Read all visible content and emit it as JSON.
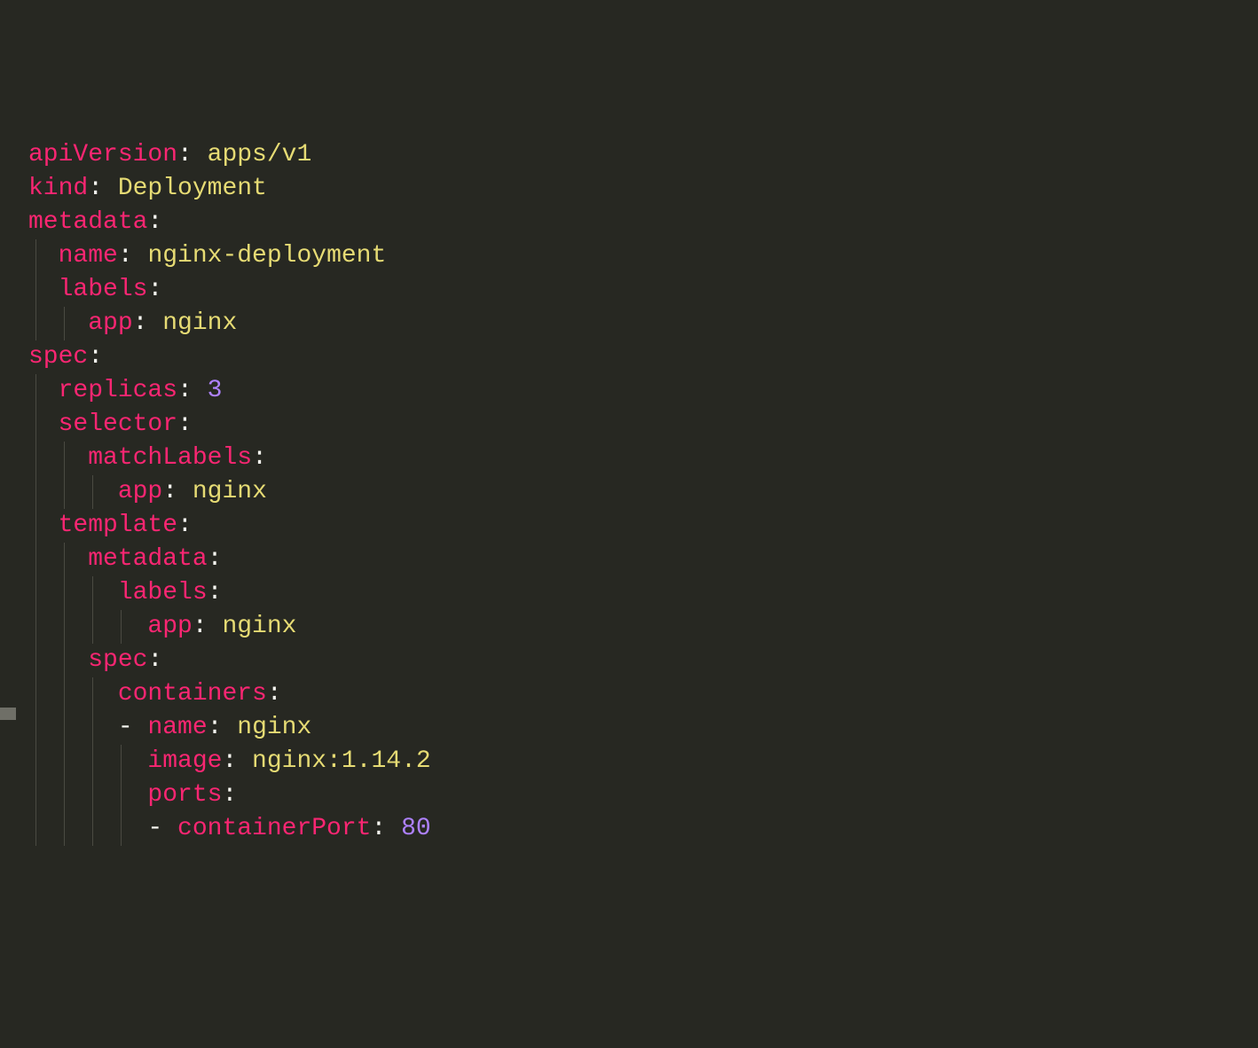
{
  "code": {
    "lines": [
      {
        "indent": 0,
        "guides": [],
        "tokens": [
          {
            "t": "key",
            "v": "apiVersion"
          },
          {
            "t": "punct",
            "v": ": "
          },
          {
            "t": "str",
            "v": "apps/v1"
          }
        ]
      },
      {
        "indent": 0,
        "guides": [],
        "tokens": [
          {
            "t": "key",
            "v": "kind"
          },
          {
            "t": "punct",
            "v": ": "
          },
          {
            "t": "str",
            "v": "Deployment"
          }
        ]
      },
      {
        "indent": 0,
        "guides": [],
        "tokens": [
          {
            "t": "key",
            "v": "metadata"
          },
          {
            "t": "punct",
            "v": ":"
          }
        ]
      },
      {
        "indent": 1,
        "guides": [
          1
        ],
        "tokens": [
          {
            "t": "key",
            "v": "name"
          },
          {
            "t": "punct",
            "v": ": "
          },
          {
            "t": "str",
            "v": "nginx-deployment"
          }
        ]
      },
      {
        "indent": 1,
        "guides": [
          1
        ],
        "tokens": [
          {
            "t": "key",
            "v": "labels"
          },
          {
            "t": "punct",
            "v": ":"
          }
        ]
      },
      {
        "indent": 2,
        "guides": [
          1,
          2
        ],
        "tokens": [
          {
            "t": "key",
            "v": "app"
          },
          {
            "t": "punct",
            "v": ": "
          },
          {
            "t": "str",
            "v": "nginx"
          }
        ]
      },
      {
        "indent": 0,
        "guides": [],
        "tokens": [
          {
            "t": "key",
            "v": "spec"
          },
          {
            "t": "punct",
            "v": ":"
          }
        ]
      },
      {
        "indent": 1,
        "guides": [
          1
        ],
        "tokens": [
          {
            "t": "key",
            "v": "replicas"
          },
          {
            "t": "punct",
            "v": ": "
          },
          {
            "t": "num",
            "v": "3"
          }
        ]
      },
      {
        "indent": 1,
        "guides": [
          1
        ],
        "tokens": [
          {
            "t": "key",
            "v": "selector"
          },
          {
            "t": "punct",
            "v": ":"
          }
        ]
      },
      {
        "indent": 2,
        "guides": [
          1,
          2
        ],
        "tokens": [
          {
            "t": "key",
            "v": "matchLabels"
          },
          {
            "t": "punct",
            "v": ":"
          }
        ]
      },
      {
        "indent": 3,
        "guides": [
          1,
          2,
          3
        ],
        "tokens": [
          {
            "t": "key",
            "v": "app"
          },
          {
            "t": "punct",
            "v": ": "
          },
          {
            "t": "str",
            "v": "nginx"
          }
        ]
      },
      {
        "indent": 1,
        "guides": [
          1
        ],
        "tokens": [
          {
            "t": "key",
            "v": "template"
          },
          {
            "t": "punct",
            "v": ":"
          }
        ]
      },
      {
        "indent": 2,
        "guides": [
          1,
          2
        ],
        "tokens": [
          {
            "t": "key",
            "v": "metadata"
          },
          {
            "t": "punct",
            "v": ":"
          }
        ]
      },
      {
        "indent": 3,
        "guides": [
          1,
          2,
          3
        ],
        "tokens": [
          {
            "t": "key",
            "v": "labels"
          },
          {
            "t": "punct",
            "v": ":"
          }
        ]
      },
      {
        "indent": 4,
        "guides": [
          1,
          2,
          3,
          4
        ],
        "tokens": [
          {
            "t": "key",
            "v": "app"
          },
          {
            "t": "punct",
            "v": ": "
          },
          {
            "t": "str",
            "v": "nginx"
          }
        ]
      },
      {
        "indent": 2,
        "guides": [
          1,
          2
        ],
        "tokens": [
          {
            "t": "key",
            "v": "spec"
          },
          {
            "t": "punct",
            "v": ":"
          }
        ]
      },
      {
        "indent": 3,
        "guides": [
          1,
          2,
          3
        ],
        "tokens": [
          {
            "t": "key",
            "v": "containers"
          },
          {
            "t": "punct",
            "v": ":"
          }
        ]
      },
      {
        "indent": 3,
        "guides": [
          1,
          2,
          3
        ],
        "tokens": [
          {
            "t": "dash",
            "v": "- "
          },
          {
            "t": "key",
            "v": "name"
          },
          {
            "t": "punct",
            "v": ": "
          },
          {
            "t": "str",
            "v": "nginx"
          }
        ]
      },
      {
        "indent": 4,
        "guides": [
          1,
          2,
          3,
          4
        ],
        "tokens": [
          {
            "t": "key",
            "v": "image"
          },
          {
            "t": "punct",
            "v": ": "
          },
          {
            "t": "str",
            "v": "nginx:1.14.2"
          }
        ]
      },
      {
        "indent": 4,
        "guides": [
          1,
          2,
          3,
          4
        ],
        "tokens": [
          {
            "t": "key",
            "v": "ports"
          },
          {
            "t": "punct",
            "v": ":"
          }
        ]
      },
      {
        "indent": 4,
        "guides": [
          1,
          2,
          3,
          4
        ],
        "tokens": [
          {
            "t": "dash",
            "v": "- "
          },
          {
            "t": "key",
            "v": "containerPort"
          },
          {
            "t": "punct",
            "v": ": "
          },
          {
            "t": "num",
            "v": "80"
          }
        ]
      }
    ]
  },
  "colors": {
    "background": "#272822",
    "key": "#f92672",
    "string": "#e6db74",
    "number": "#ae81ff",
    "default": "#f8f8f2"
  }
}
